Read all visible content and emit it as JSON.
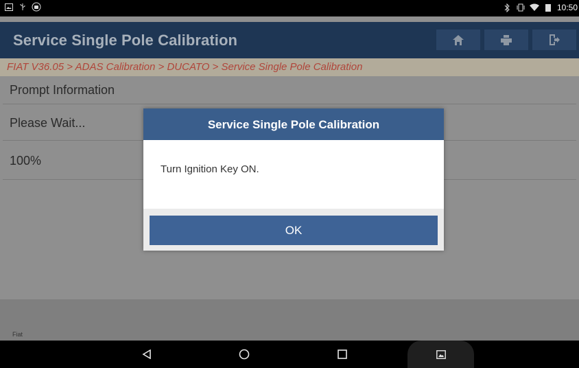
{
  "status_bar": {
    "time": "10:50",
    "left_icons": [
      "gallery-icon",
      "usb-icon",
      "android-debug-icon"
    ],
    "right_icons": [
      "bluetooth-icon",
      "vibrate-icon",
      "wifi-icon",
      "battery-icon"
    ]
  },
  "header": {
    "title": "Service Single Pole Calibration",
    "buttons": [
      "home-icon",
      "print-icon",
      "exit-icon"
    ]
  },
  "breadcrumb": "FIAT V36.05 > ADAS Calibration > DUCATO > Service Single Pole Calibration",
  "rows": {
    "prompt": "Prompt Information",
    "status": "Please Wait...",
    "progress": "100%"
  },
  "footer_label": "Fiat",
  "dialog": {
    "title": "Service Single Pole Calibration",
    "message": "Turn Ignition Key ON.",
    "ok_label": "OK"
  },
  "nav_bar": {
    "buttons": [
      "back-icon",
      "home-circle-icon",
      "recents-icon",
      "screenshot-icon"
    ]
  },
  "colors": {
    "dialog_header": "#3a5e8c",
    "ok_button": "#3e6396",
    "breadcrumb_text": "#b0453a"
  }
}
